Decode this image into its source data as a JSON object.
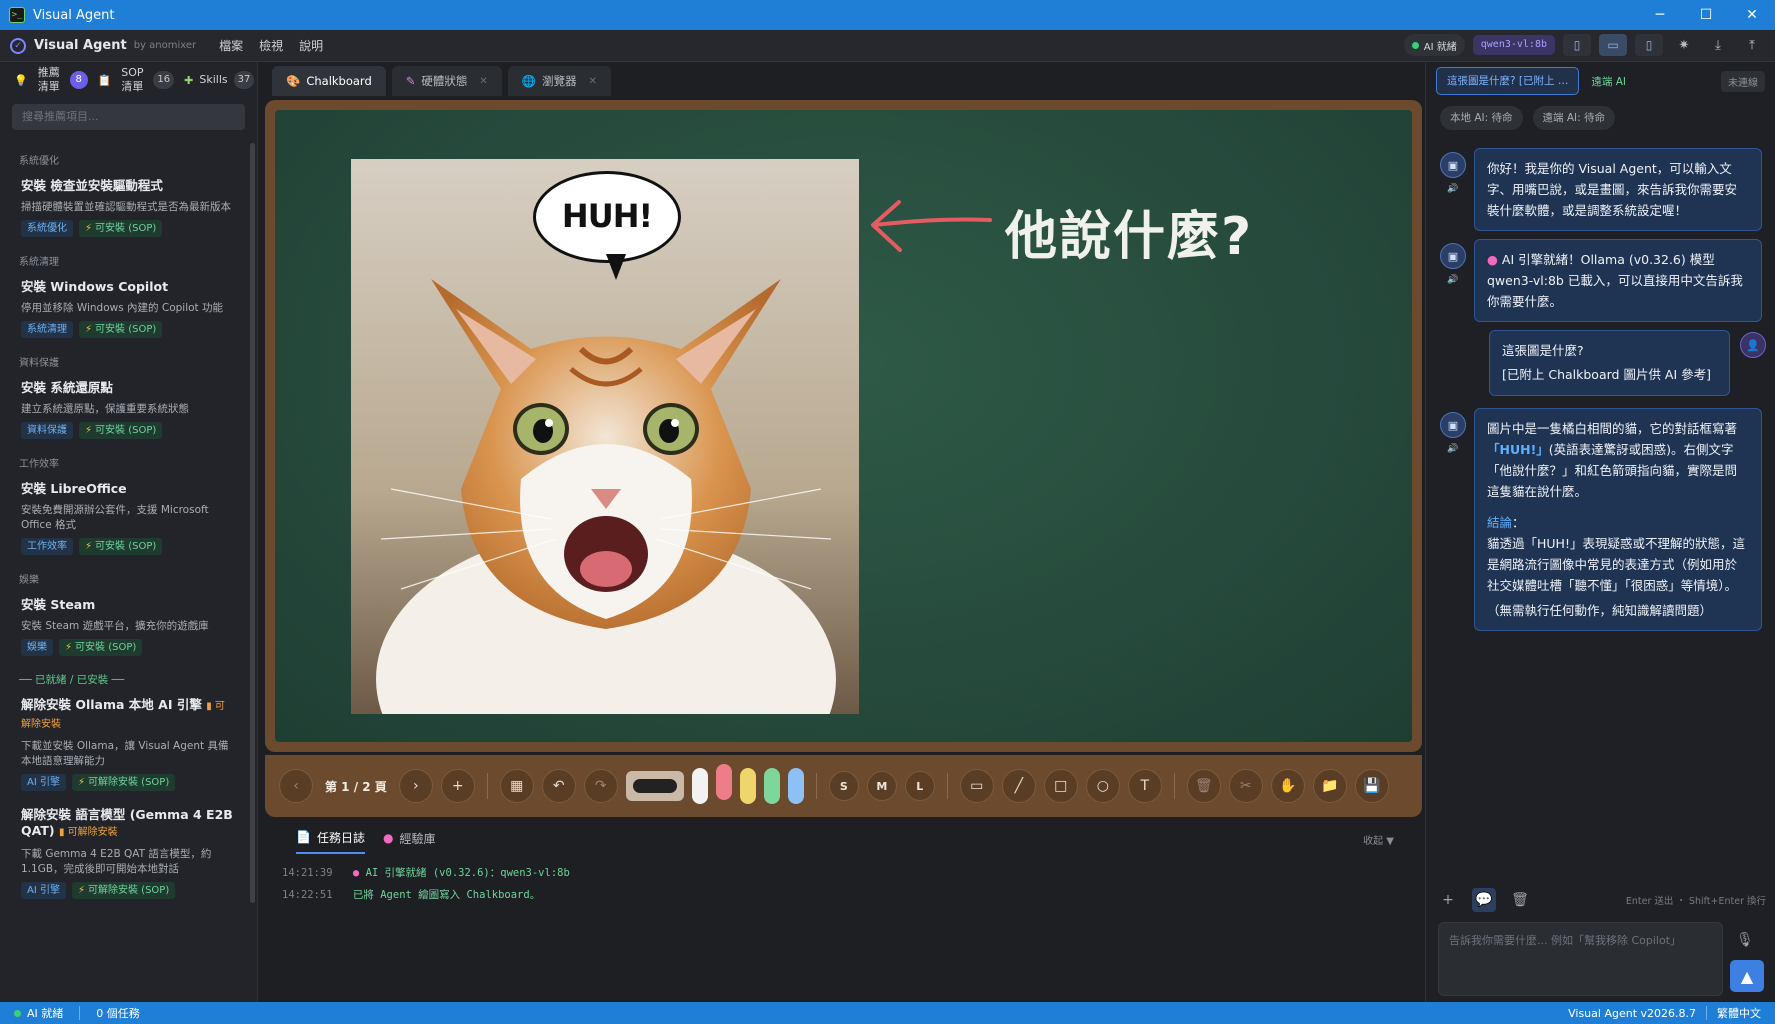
{
  "window": {
    "title": "Visual Agent",
    "app_icon": "terminal-icon",
    "controls": [
      "─",
      "☐",
      "✕"
    ]
  },
  "menubar": {
    "brand": "Visual Agent",
    "byline": "by anomixer",
    "menus": [
      "檔案",
      "檢視",
      "說明"
    ],
    "ai_status": "AI 就緒",
    "model": "qwen3-vl:8b"
  },
  "sidebar": {
    "tabs": [
      {
        "label": "推薦清單",
        "icon": "bulb-icon",
        "count": "8"
      },
      {
        "label": "SOP 清單",
        "icon": "clipboard-icon",
        "count": "16"
      },
      {
        "label": "Skills",
        "icon": "puzzle-icon",
        "count": "37"
      }
    ],
    "search_placeholder": "搜尋推薦項目...",
    "items": [
      {
        "category": "系統優化",
        "title": "安裝 檢查並安裝驅動程式",
        "desc": "掃描硬體裝置並確認驅動程式是否為最新版本",
        "tag": "系統優化",
        "action": "可安裝 (SOP)"
      },
      {
        "category": "系統清理",
        "title": "安裝 Windows Copilot",
        "desc": "停用並移除 Windows 內建的 Copilot 功能",
        "tag": "系統清理",
        "action": "可安裝 (SOP)"
      },
      {
        "category": "資料保護",
        "title": "安裝 系統還原點",
        "desc": "建立系統還原點，保護重要系統狀態",
        "tag": "資料保護",
        "action": "可安裝 (SOP)"
      },
      {
        "category": "工作效率",
        "title": "安裝 LibreOffice",
        "desc": "安裝免費開源辦公套件，支援 Microsoft Office 格式",
        "tag": "工作效率",
        "action": "可安裝 (SOP)"
      },
      {
        "category": "娛樂",
        "title": "安裝 Steam",
        "desc": "安裝 Steam 遊戲平台，擴充你的遊戲庫",
        "tag": "娛樂",
        "action": "可安裝 (SOP)"
      }
    ],
    "installed_divider": "── 已就緒 / 已安裝 ──",
    "installed": [
      {
        "title": "解除安裝 Ollama 本地 AI 引擎",
        "inline": "可解除安裝",
        "desc": "下載並安裝 Ollama，讓 Visual Agent 具備本地語意理解能力",
        "tag": "AI 引擎",
        "action": "可解除安裝 (SOP)"
      },
      {
        "title": "解除安裝 語言模型 (Gemma 4 E2B QAT)",
        "inline": "可解除安裝",
        "desc": "下載 Gemma 4 E2B QAT 語言模型，約 1.1GB，完成後即可開始本地對話",
        "tag": "AI 引擎",
        "action": "可解除安裝 (SOP)"
      }
    ]
  },
  "center": {
    "tabs": [
      {
        "label": "Chalkboard",
        "icon": "palette-icon"
      },
      {
        "label": "硬體狀態",
        "icon": "wrench-icon"
      },
      {
        "label": "瀏覽器",
        "icon": "globe-icon"
      }
    ],
    "board": {
      "bubble_text": "HUH!",
      "chalk_text": "他說什麼?"
    },
    "toolbar": {
      "page_label": "第 1 / 2 頁",
      "sizes": [
        "S",
        "M",
        "L"
      ],
      "chalk_colors": [
        "#f2f2f2",
        "#ee7d8a",
        "#f0d66a",
        "#7fd69a",
        "#8ec0f5"
      ]
    },
    "log": {
      "tabs": [
        "任務日誌",
        "經驗庫"
      ],
      "collapse": "收起 ▼",
      "lines": [
        {
          "ts": "14:21:39",
          "msg": "AI 引擎就緒 (v0.32.6)：qwen3-vl:8b"
        },
        {
          "ts": "14:22:51",
          "msg": "已將 Agent 繪圖寫入 Chalkboard。"
        }
      ]
    }
  },
  "chat": {
    "tabs": {
      "active": "這張圖是什麼? [已附上 …",
      "remote": "遠端 AI",
      "disconnected": "未連線"
    },
    "status": {
      "local": "本地 AI: 待命",
      "remote": "遠端 AI: 待命"
    },
    "messages": {
      "m1": "你好！我是你的 Visual Agent，可以輸入文字、用嘴巴說，或是畫圖，來告訴我你需要安裝什麼軟體，或是調整系統設定喔！",
      "m2": "AI 引擎就緒！Ollama (v0.32.6) 模型 qwen3-vl:8b 已載入，可以直接用中文告訴我你需要什麼。",
      "user1": "這張圖是什麼?",
      "user2": "[已附上 Chalkboard 圖片供 AI 參考]",
      "m3a": "圖片中是一隻橘白相間的貓，它的對話框寫著",
      "m3b": "「HUH!」",
      "m3c": "(英語表達驚訝或困惑)。右側文字「他說什麼？」和紅色箭頭指向貓，實際是問這隻貓在說什麼。",
      "m3d": "結論",
      "m3e": "：",
      "m3f": "貓透過「HUH!」表現疑惑或不理解的狀態，這是網路流行圖像中常見的表達方式（例如用於社交媒體吐槽「聽不懂」「很困惑」等情境）。",
      "m3g": "（無需執行任何動作，純知識解讀問題）"
    },
    "hint": "Enter 送出 ・ Shift+Enter 換行",
    "input_placeholder": "告訴我你需要什麼... 例如「幫我移除 Copilot」"
  },
  "statusbar": {
    "ai": "AI 就緒",
    "tasks": "0 個任務",
    "version": "Visual Agent v2026.8.7",
    "language": "繁體中文"
  }
}
